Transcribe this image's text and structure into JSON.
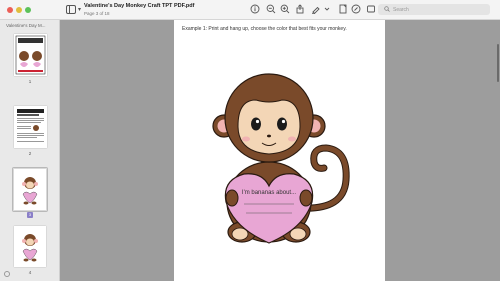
{
  "window": {
    "title": "Valentine's Day Monkey Craft TPT PDF.pdf",
    "subtitle": "Page 3 of 18"
  },
  "toolbar": {
    "icons": [
      "sidebar-icon",
      "info-icon",
      "zoom-out-icon",
      "zoom-in-icon",
      "share-icon",
      "highlight-icon",
      "chevron-down-icon",
      "page-icon",
      "rotate-icon",
      "markup-icon",
      "search-icon"
    ],
    "search_placeholder": "Search"
  },
  "sidebar": {
    "title": "Valentine's Day M...",
    "thumbnails": [
      {
        "number": "1"
      },
      {
        "number": "2"
      },
      {
        "number": "3"
      },
      {
        "number": "4"
      }
    ],
    "selected_page": "3"
  },
  "page": {
    "instruction": "Example 1: Print and hang up, choose the color that best fits your monkey.",
    "heart_text": "I'm bananas about..."
  },
  "colors": {
    "monkey_brown": "#7a4a2a",
    "monkey_face": "#f3d6b6",
    "heart_pink": "#e8a6d4",
    "ear_pink": "#f1b3b3"
  }
}
